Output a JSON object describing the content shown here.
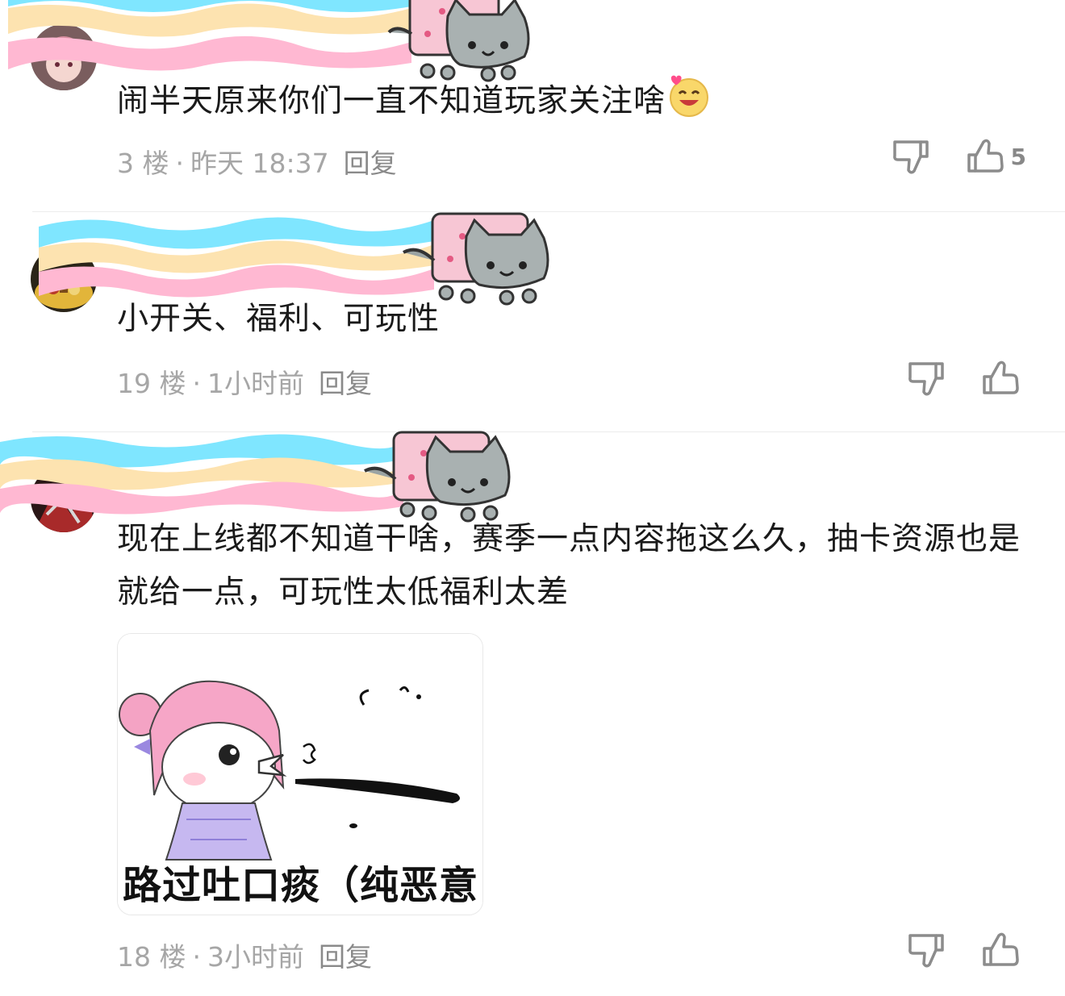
{
  "comments": [
    {
      "text": "闹半天原来你们一直不知道玩家关注啥",
      "emoji": "grinning-face-with-heart-emoji",
      "floor": "3 楼",
      "sep": "·",
      "time": "昨天 18:37",
      "reply": "回复",
      "like_count": "5"
    },
    {
      "text": "小开关、福利、可玩性",
      "floor": "19 楼",
      "sep": "·",
      "time": "1小时前",
      "reply": "回复",
      "like_count": ""
    },
    {
      "text": "现在上线都不知道干啥，赛季一点内容拖这么久，抽卡资源也是就给一点，可玩性太低福利太差",
      "sticker_caption": "路过吐口痰（纯恶意",
      "floor": "18 楼",
      "sep": "·",
      "time": "3小时前",
      "reply": "回复",
      "like_count": ""
    }
  ],
  "colors": {
    "rainbow_blue": "#7fe6ff",
    "rainbow_yellow": "#fde3b0",
    "rainbow_pink": "#ffb8d2",
    "meta_text": "#a6a6a6",
    "icon_stroke": "#8c8c8c"
  }
}
